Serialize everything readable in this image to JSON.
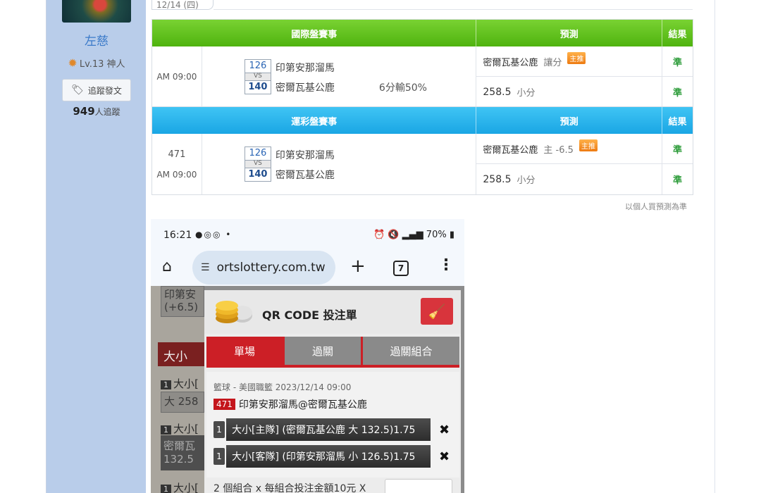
{
  "sidebar": {
    "user_name": "左慈",
    "level": "Lv.13 神人",
    "follow_button": "追蹤發文",
    "follower_count": "949",
    "follower_suffix": "人追蹤"
  },
  "date_tab": "12/14 (四)",
  "international": {
    "header": {
      "event": "國際盤賽事",
      "prediction": "預測",
      "result": "結果"
    },
    "row": {
      "code": "",
      "time": "AM 09:00",
      "away_score": "126",
      "vs": "VS",
      "home_score": "140",
      "away_team": "印第安那溜馬",
      "home_team": "密爾瓦基公鹿",
      "handicap": "6分輸50%",
      "predictions": [
        {
          "pick": "密爾瓦基公鹿",
          "detail": "讓分",
          "badge": "主推",
          "result": "準"
        },
        {
          "pick": "258.5",
          "detail": "小分",
          "badge": "",
          "result": "準"
        }
      ]
    }
  },
  "sports_lottery": {
    "header": {
      "event": "運彩盤賽事",
      "prediction": "預測",
      "result": "結果"
    },
    "row": {
      "code": "471",
      "time": "AM 09:00",
      "away_score": "126",
      "vs": "VS",
      "home_score": "140",
      "away_team": "印第安那溜馬",
      "home_team": "密爾瓦基公鹿",
      "predictions": [
        {
          "pick": "密爾瓦基公鹿",
          "detail": "主 -6.5",
          "badge": "主推",
          "result": "準"
        },
        {
          "pick": "258.5",
          "detail": "小分",
          "badge": "",
          "result": "準"
        }
      ]
    }
  },
  "note": "以個人買預測為準",
  "phone": {
    "status_time": "16:21",
    "status_dot": "•",
    "battery": "70%",
    "url": "ortslottery.com.tw",
    "tab_count": "7",
    "background": {
      "block1_line1": "印第安",
      "block1_line2": "(+6.5)",
      "section": "大小",
      "item1": "大小[",
      "item1_value": "大 258",
      "item2": "大小[",
      "item2_value1": "密爾瓦",
      "item2_value2": "132.5",
      "item3": "大小["
    },
    "modal": {
      "title": "QR CODE 投注單",
      "tabs": [
        "單場",
        "過關",
        "過關組合"
      ],
      "league": "籃球 - 美國職籃 2023/12/14 09:00",
      "match_code": "471",
      "match": "印第安那溜馬@密爾瓦基公鹿",
      "picks": [
        {
          "index": "1",
          "text": "大小[主隊] (密爾瓦基公鹿 大 132.5)1.75"
        },
        {
          "index": "1",
          "text": "大小[客隊] (印第安那溜馬 小 126.5)1.75"
        }
      ],
      "summary": "2 個組合 x 每組合投注金額10元 X"
    }
  }
}
